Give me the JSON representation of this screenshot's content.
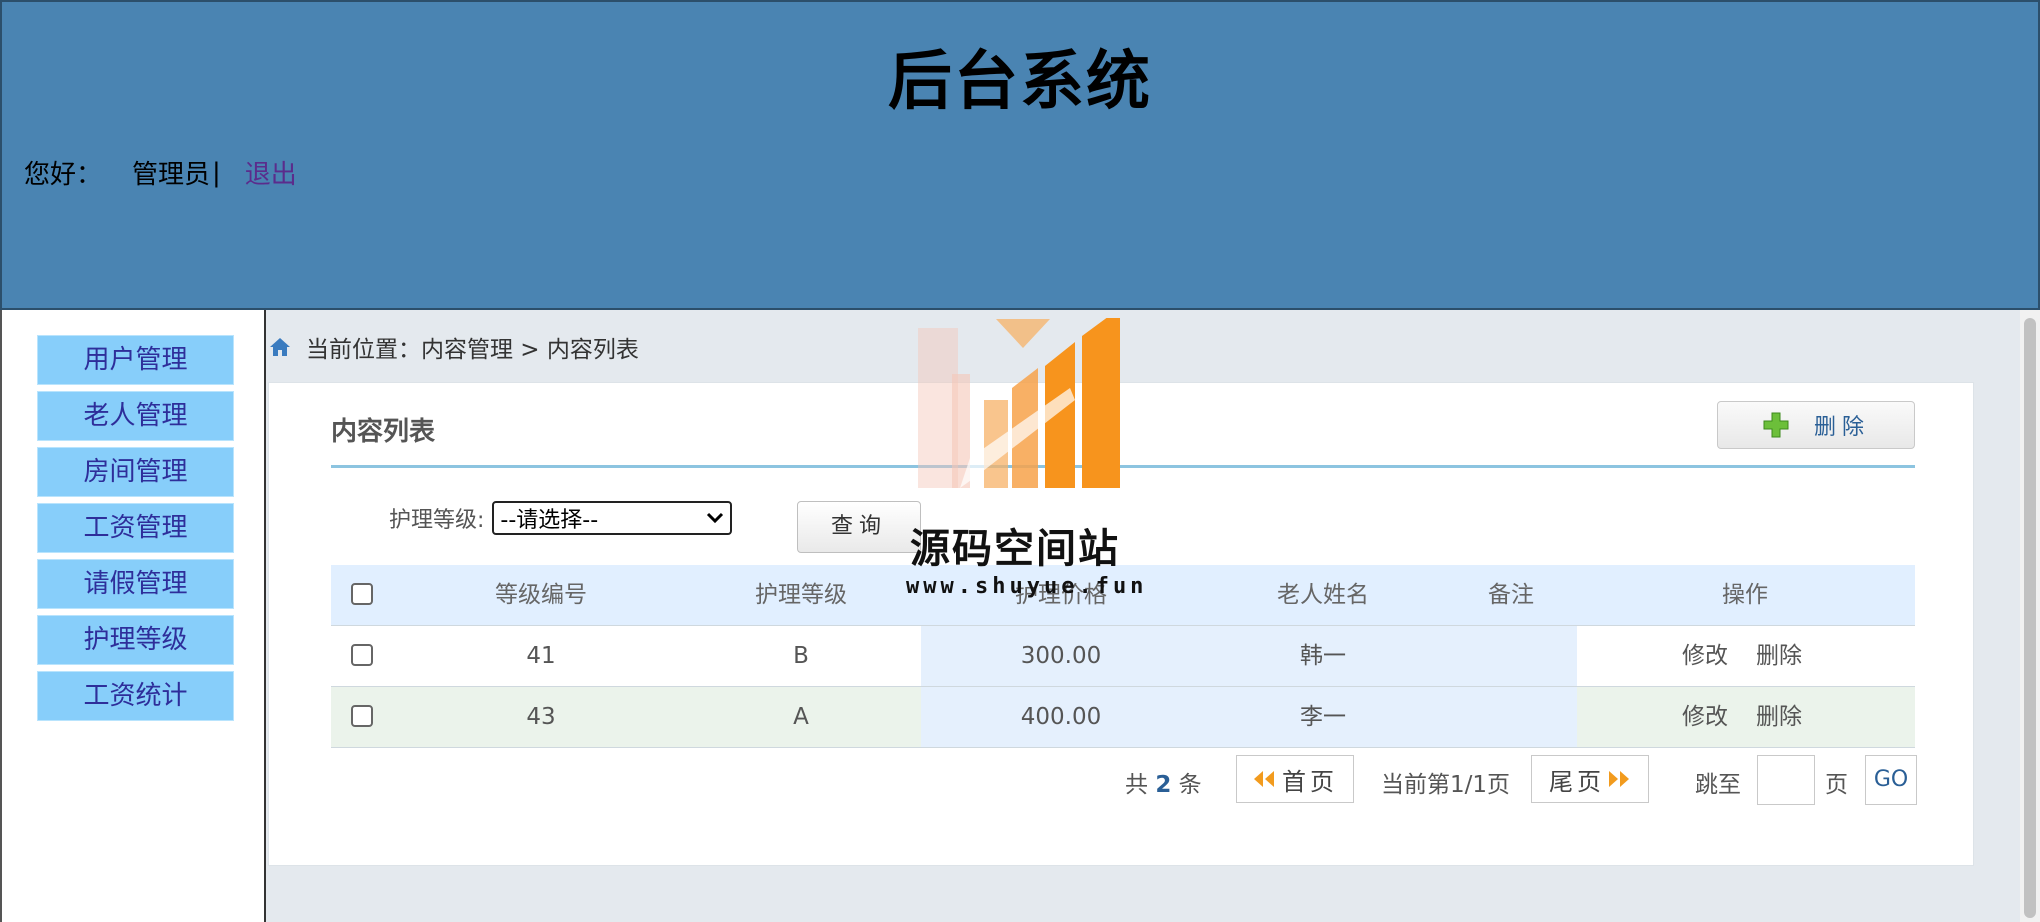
{
  "header": {
    "title": "后台系统",
    "greeting": "您好：",
    "username": "管理员",
    "separator": "|",
    "logout": "退出"
  },
  "sidebar": {
    "items": [
      {
        "label": "用户管理"
      },
      {
        "label": "老人管理"
      },
      {
        "label": "房间管理"
      },
      {
        "label": "工资管理"
      },
      {
        "label": "请假管理"
      },
      {
        "label": "护理等级"
      },
      {
        "label": "工资统计"
      }
    ]
  },
  "breadcrumb": {
    "text": "当前位置：内容管理 > 内容列表"
  },
  "panel": {
    "title": "内容列表",
    "delete_button": "删除"
  },
  "filter": {
    "label": "护理等级:",
    "select_value": "--请选择--",
    "query_button": "查询"
  },
  "table": {
    "headers": [
      "等级编号",
      "护理等级",
      "护理价格",
      "老人姓名",
      "备注",
      "操作"
    ],
    "rows": [
      {
        "id": "41",
        "level": "B",
        "price": "300.00",
        "name": "韩一",
        "note": "",
        "edit": "修改",
        "delete": "删除"
      },
      {
        "id": "43",
        "level": "A",
        "price": "400.00",
        "name": "李一",
        "note": "",
        "edit": "修改",
        "delete": "删除"
      }
    ]
  },
  "pagination": {
    "total_prefix": "共",
    "total_count": "2",
    "total_suffix": "条",
    "first": "首页",
    "current": "当前第1/1页",
    "last": "尾页",
    "jump_label": "跳至",
    "page_unit": "页",
    "go": "GO"
  },
  "watermark": {
    "title": "源码空间站",
    "url": "www.shuyue.fun"
  },
  "colors": {
    "header_bg": "#4a84b2",
    "sidebar_item_bg": "#87cefa",
    "link": "#2a5f96",
    "logout": "#5b2c8c",
    "watermark_orange": "#f7941d"
  }
}
